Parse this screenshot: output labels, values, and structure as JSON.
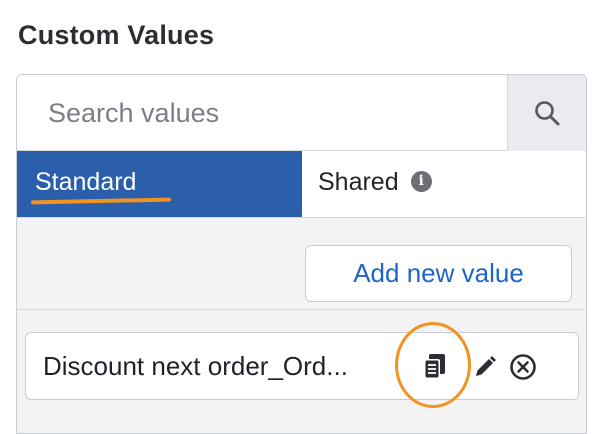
{
  "section": {
    "title": "Custom Values"
  },
  "search": {
    "placeholder": "Search values",
    "value": ""
  },
  "tabs": [
    {
      "label": "Standard",
      "active": true
    },
    {
      "label": "Shared",
      "active": false,
      "info_icon": "info-icon"
    }
  ],
  "toolbar": {
    "add_label": "Add new value"
  },
  "values": [
    {
      "label": "Discount next order_Ord...",
      "actions": [
        "copy-icon",
        "pencil-icon",
        "close-circle-icon"
      ]
    }
  ],
  "colors": {
    "active_tab": "#2b5eab",
    "accent_link": "#1f65c8",
    "annotation": "#f2921f"
  }
}
